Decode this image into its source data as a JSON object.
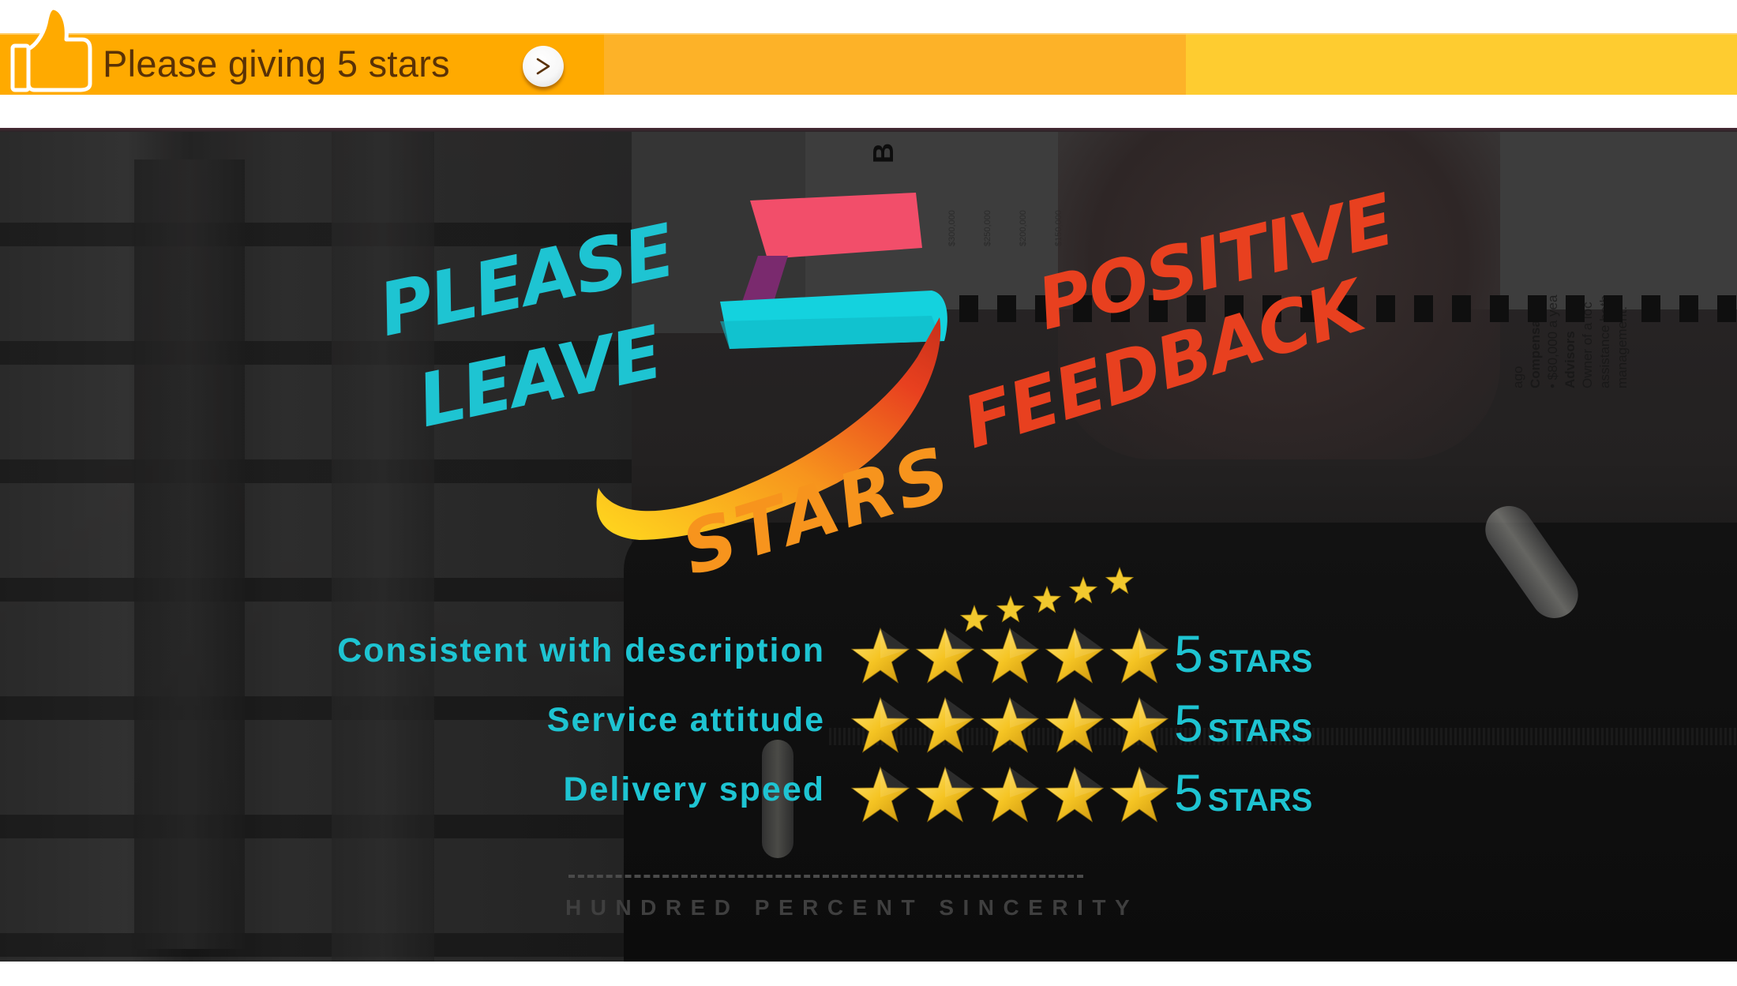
{
  "banner": {
    "text": "Please giving 5 stars",
    "icon": "thumbs-up-icon",
    "next_button": {
      "label": ">",
      "icon": "chevron-right-icon"
    },
    "colors": {
      "primary": "#FFAA00",
      "middle": "#FDB228",
      "right": "#FECC30",
      "text": "#5A3206"
    }
  },
  "hero": {
    "headline": {
      "line1": "PLEASE",
      "line2": "LEAVE",
      "number": "5",
      "stars_word": "STARS",
      "line3": "POSITIVE",
      "line4": "FEEDBACK"
    },
    "decorative_star_count": 5,
    "background_document": {
      "title_fragment": "B",
      "text_lines": [
        "ago",
        "Compensatio",
        "• $80,000 a yea",
        "Advisors",
        "Owner of a loc",
        "assistance both",
        "management."
      ],
      "amounts": [
        "$300,000",
        "$250,000",
        "$200,000",
        "$150,000"
      ]
    },
    "colors": {
      "cyan": "#1EC4D2",
      "orange": "#F7941D",
      "red": "#E8401F",
      "pink": "#F24E6A",
      "purple": "#7A2A6E",
      "yellow": "#FFD91E"
    }
  },
  "ratings": [
    {
      "label": "Consistent with description",
      "stars": 5,
      "max_stars": 5,
      "value": "5",
      "unit": "STARS"
    },
    {
      "label": "Service attitude",
      "stars": 5,
      "max_stars": 5,
      "value": "5",
      "unit": "STARS"
    },
    {
      "label": "Delivery speed",
      "stars": 5,
      "max_stars": 5,
      "value": "5",
      "unit": "STARS"
    }
  ],
  "footer": {
    "tagline": "HUNDRED PERCENT SINCERITY"
  }
}
